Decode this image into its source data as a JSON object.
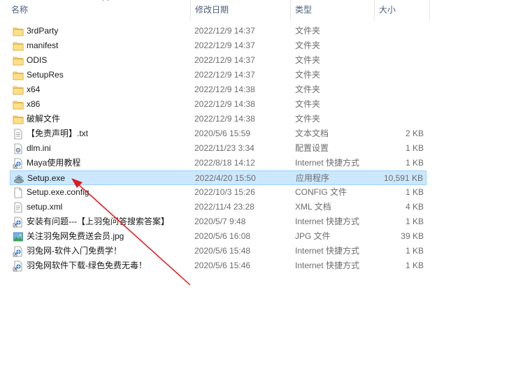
{
  "columns": {
    "name": "名称",
    "date": "修改日期",
    "type": "类型",
    "size": "大小"
  },
  "files": [
    {
      "name": "3rdParty",
      "date": "2022/12/9 14:37",
      "type": "文件夹",
      "size": "",
      "icon": "folder-icon"
    },
    {
      "name": "manifest",
      "date": "2022/12/9 14:37",
      "type": "文件夹",
      "size": "",
      "icon": "folder-icon"
    },
    {
      "name": "ODIS",
      "date": "2022/12/9 14:37",
      "type": "文件夹",
      "size": "",
      "icon": "folder-icon"
    },
    {
      "name": "SetupRes",
      "date": "2022/12/9 14:37",
      "type": "文件夹",
      "size": "",
      "icon": "folder-icon"
    },
    {
      "name": "x64",
      "date": "2022/12/9 14:38",
      "type": "文件夹",
      "size": "",
      "icon": "folder-icon"
    },
    {
      "name": "x86",
      "date": "2022/12/9 14:38",
      "type": "文件夹",
      "size": "",
      "icon": "folder-icon"
    },
    {
      "name": "破解文件",
      "date": "2022/12/9 14:38",
      "type": "文件夹",
      "size": "",
      "icon": "folder-icon"
    },
    {
      "name": "【免责声明】.txt",
      "date": "2020/5/6 15:59",
      "type": "文本文档",
      "size": "2 KB",
      "icon": "text-file-icon"
    },
    {
      "name": "dlm.ini",
      "date": "2022/11/23 3:34",
      "type": "配置设置",
      "size": "1 KB",
      "icon": "settings-file-icon"
    },
    {
      "name": "Maya使用教程",
      "date": "2022/8/18 14:12",
      "type": "Internet 快捷方式",
      "size": "1 KB",
      "icon": "internet-shortcut-icon"
    },
    {
      "name": "Setup.exe",
      "date": "2022/4/20 15:50",
      "type": "应用程序",
      "size": "10,591 KB",
      "icon": "installer-icon"
    },
    {
      "name": "Setup.exe.config",
      "date": "2022/10/3 15:26",
      "type": "CONFIG 文件",
      "size": "1 KB",
      "icon": "blank-file-icon"
    },
    {
      "name": "setup.xml",
      "date": "2022/11/4 23:28",
      "type": "XML 文档",
      "size": "4 KB",
      "icon": "xml-file-icon"
    },
    {
      "name": "安装有问题---【上羽兔问答搜索答案】",
      "date": "2020/5/7 9:48",
      "type": "Internet 快捷方式",
      "size": "1 KB",
      "icon": "internet-shortcut-icon"
    },
    {
      "name": "关注羽兔网免费送会员.jpg",
      "date": "2020/5/6 16:08",
      "type": "JPG 文件",
      "size": "39 KB",
      "icon": "image-file-icon"
    },
    {
      "name": "羽兔网-软件入门免费学！",
      "date": "2020/5/6 15:48",
      "type": "Internet 快捷方式",
      "size": "1 KB",
      "icon": "internet-shortcut-icon"
    },
    {
      "name": "羽兔网软件下载-绿色免费无毒！",
      "date": "2020/5/6 15:46",
      "type": "Internet 快捷方式",
      "size": "1 KB",
      "icon": "internet-shortcut-icon"
    }
  ],
  "selected_index": 10,
  "annotation_color": "#e0191e"
}
